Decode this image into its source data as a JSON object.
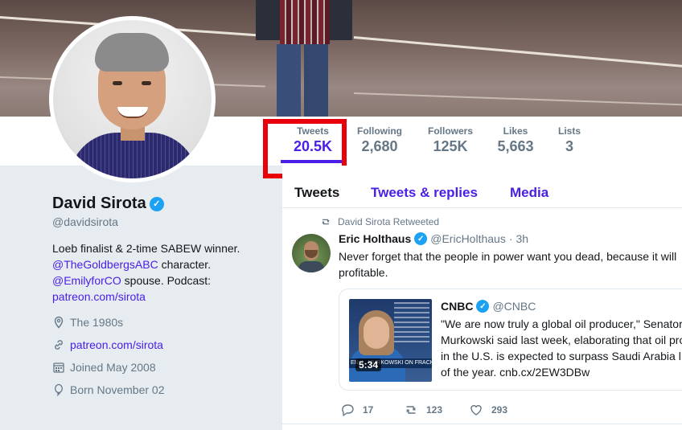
{
  "stats": [
    {
      "label": "Tweets",
      "value": "20.5K"
    },
    {
      "label": "Following",
      "value": "2,680"
    },
    {
      "label": "Followers",
      "value": "125K"
    },
    {
      "label": "Likes",
      "value": "5,663"
    },
    {
      "label": "Lists",
      "value": "3"
    }
  ],
  "profile": {
    "name": "David Sirota",
    "handle": "@davidsirota",
    "bio_line1": "Loeb finalist & 2-time SABEW winner.",
    "bio_link1": "@TheGoldbergsABC",
    "bio_line2_rest": " character.",
    "bio_link2": "@EmilyforCO",
    "bio_line3_rest": " spouse. Podcast:",
    "bio_link3": "patreon.com/sirota",
    "location": "The 1980s",
    "website": "patreon.com/sirota",
    "joined": "Joined May 2008",
    "born": "Born November 02"
  },
  "tabs": [
    {
      "label": "Tweets"
    },
    {
      "label": "Tweets & replies"
    },
    {
      "label": "Media"
    }
  ],
  "tweet": {
    "retweet_context": "David Sirota Retweeted",
    "author": "Eric Holthaus",
    "handle": "@EricHolthaus",
    "sep": "·",
    "time": "3h",
    "text_line1": "Never forget that the people in power want you dead, because it will",
    "text_line2": "profitable.",
    "card": {
      "author": "CNBC",
      "handle": "@CNBC",
      "line1": "\"We are now truly a global oil producer,\" Senator",
      "line2": "Murkowski said last week, elaborating that oil pro",
      "line3": "in the U.S. is expected to surpass Saudi Arabia l",
      "line4": "of the year. cnb.cx/2EW3DBw",
      "video_duration": "5:34",
      "chyron": "EN. L. MURKOWSKI ON FRACKING"
    },
    "replies": "17",
    "retweets": "123",
    "likes": "293"
  },
  "colors": {
    "accent": "#4a1fe6",
    "verified": "#1da1f2",
    "highlight": "#e8000b"
  }
}
